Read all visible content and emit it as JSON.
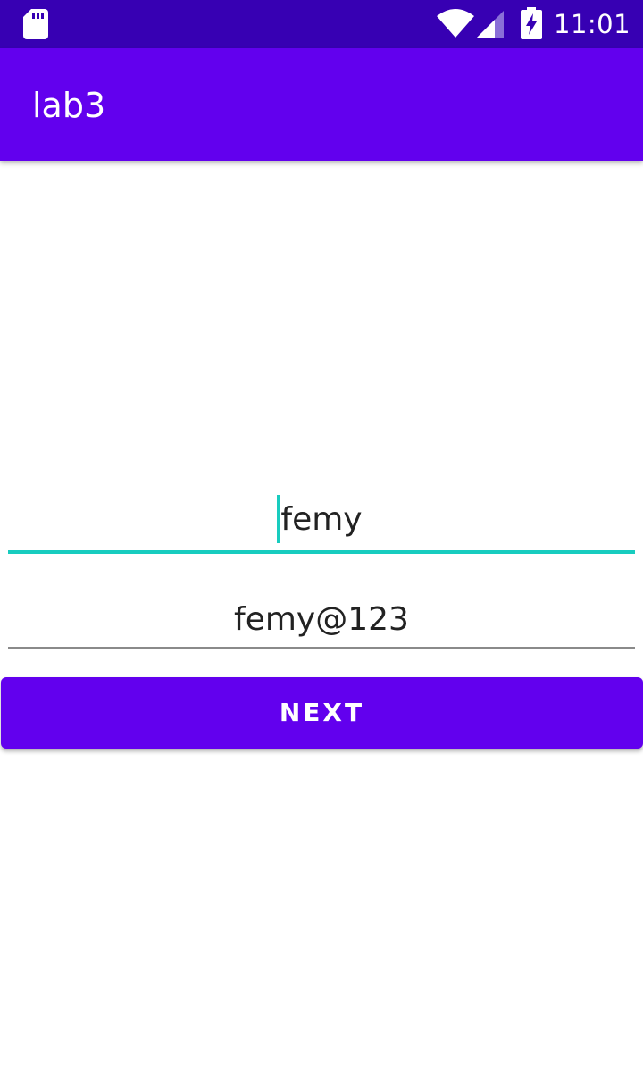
{
  "status_bar": {
    "time": "11:01",
    "icons": [
      "sd-card-icon",
      "wifi-icon",
      "cell-signal-icon",
      "battery-charging-icon"
    ],
    "background_color": "#3700b3"
  },
  "app_bar": {
    "title": "lab3",
    "background_color": "#6200ee"
  },
  "form": {
    "username": {
      "value": "femy",
      "focused": true,
      "underline_color": "#18ccbf"
    },
    "password": {
      "value": "femy@123",
      "focused": false,
      "underline_color": "#8a8a8a"
    },
    "next_button_label": "NEXT",
    "button_color": "#6200ee"
  }
}
